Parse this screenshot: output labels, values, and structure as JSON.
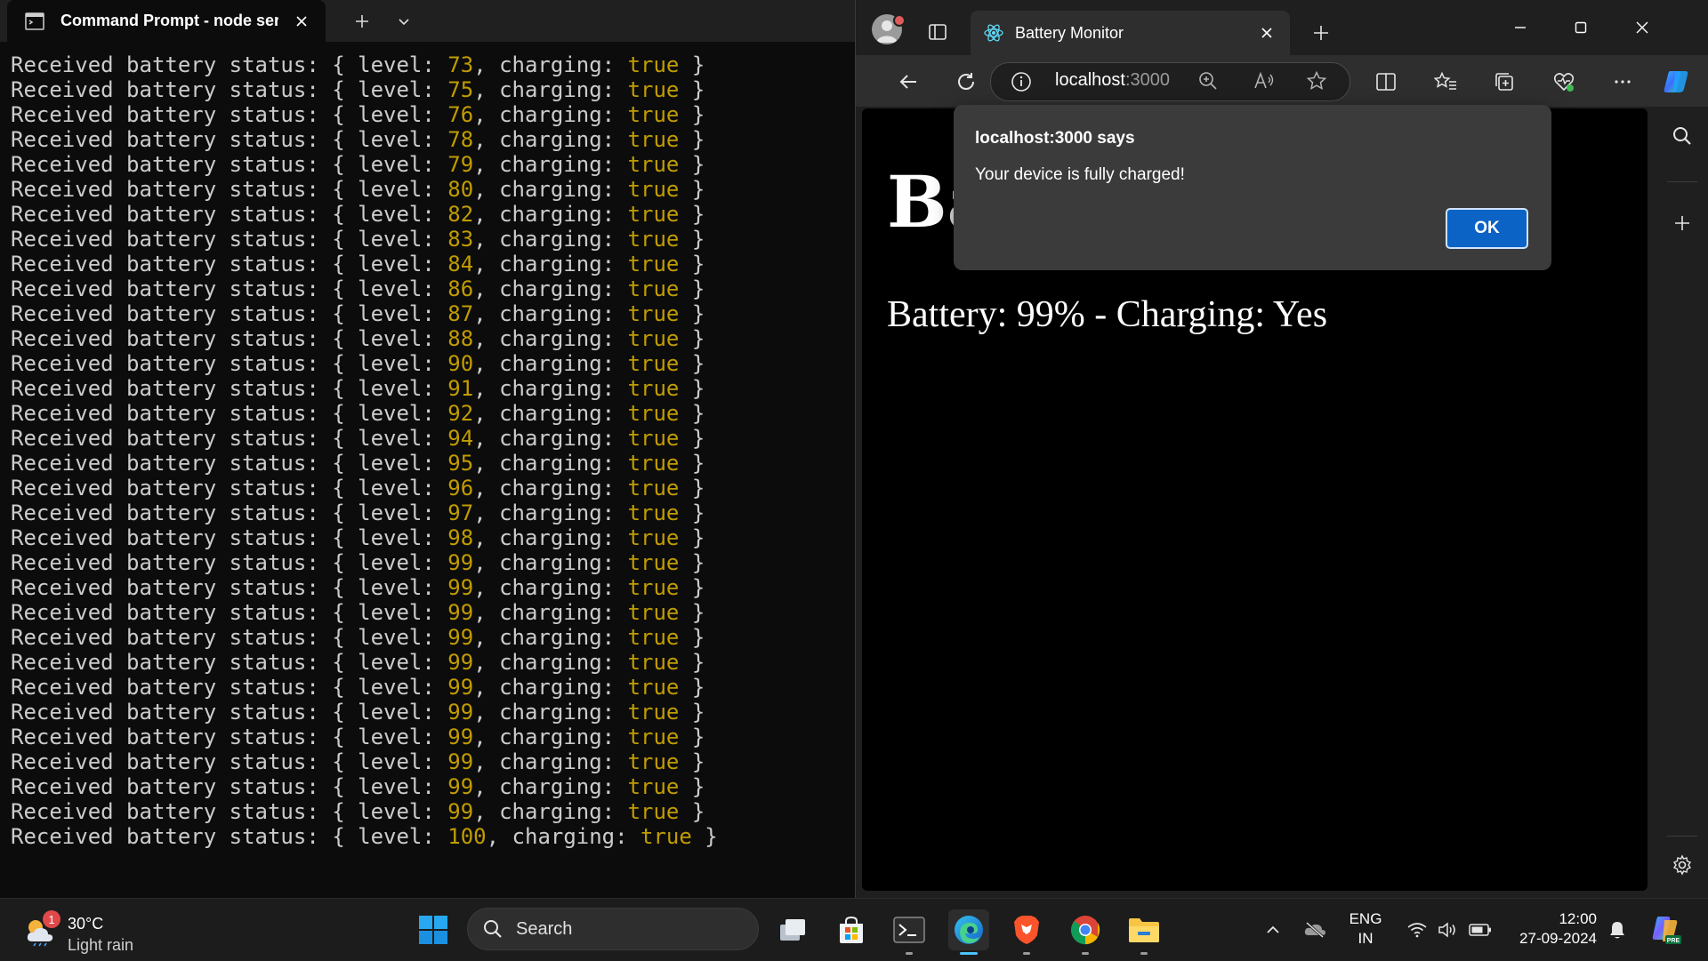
{
  "terminal": {
    "tab_title": "Command Prompt - node  ser",
    "prefix": "Received battery status: { level: ",
    "mid": ", charging: ",
    "suffix": " }",
    "lines": [
      {
        "level": "73",
        "charging": "true"
      },
      {
        "level": "75",
        "charging": "true"
      },
      {
        "level": "76",
        "charging": "true"
      },
      {
        "level": "78",
        "charging": "true"
      },
      {
        "level": "79",
        "charging": "true"
      },
      {
        "level": "80",
        "charging": "true"
      },
      {
        "level": "82",
        "charging": "true"
      },
      {
        "level": "83",
        "charging": "true"
      },
      {
        "level": "84",
        "charging": "true"
      },
      {
        "level": "86",
        "charging": "true"
      },
      {
        "level": "87",
        "charging": "true"
      },
      {
        "level": "88",
        "charging": "true"
      },
      {
        "level": "90",
        "charging": "true"
      },
      {
        "level": "91",
        "charging": "true"
      },
      {
        "level": "92",
        "charging": "true"
      },
      {
        "level": "94",
        "charging": "true"
      },
      {
        "level": "95",
        "charging": "true"
      },
      {
        "level": "96",
        "charging": "true"
      },
      {
        "level": "97",
        "charging": "true"
      },
      {
        "level": "98",
        "charging": "true"
      },
      {
        "level": "99",
        "charging": "true"
      },
      {
        "level": "99",
        "charging": "true"
      },
      {
        "level": "99",
        "charging": "true"
      },
      {
        "level": "99",
        "charging": "true"
      },
      {
        "level": "99",
        "charging": "true"
      },
      {
        "level": "99",
        "charging": "true"
      },
      {
        "level": "99",
        "charging": "true"
      },
      {
        "level": "99",
        "charging": "true"
      },
      {
        "level": "99",
        "charging": "true"
      },
      {
        "level": "99",
        "charging": "true"
      },
      {
        "level": "99",
        "charging": "true"
      },
      {
        "level": "100",
        "charging": "true"
      }
    ]
  },
  "browser": {
    "tab_title": "Battery Monitor",
    "url_host": "localhost",
    "url_port": ":3000",
    "page_heading": "Ba",
    "page_status": "Battery: 99% - Charging: Yes"
  },
  "alert": {
    "title": "localhost:3000 says",
    "message": "Your device is fully charged!",
    "ok_label": "OK"
  },
  "taskbar": {
    "weather_temp": "30°C",
    "weather_condition": "Light rain",
    "weather_badge": "1",
    "search_placeholder": "Search",
    "lang_line1": "ENG",
    "lang_line2": "IN",
    "time": "12:00",
    "date": "27-09-2024"
  },
  "colors": {
    "terminal_bg": "#0c0c0c",
    "terminal_number": "#c19c00",
    "browser_chrome": "#2e2e2e",
    "alert_button": "#0b63c5",
    "taskbar": "#1c1c1c"
  }
}
